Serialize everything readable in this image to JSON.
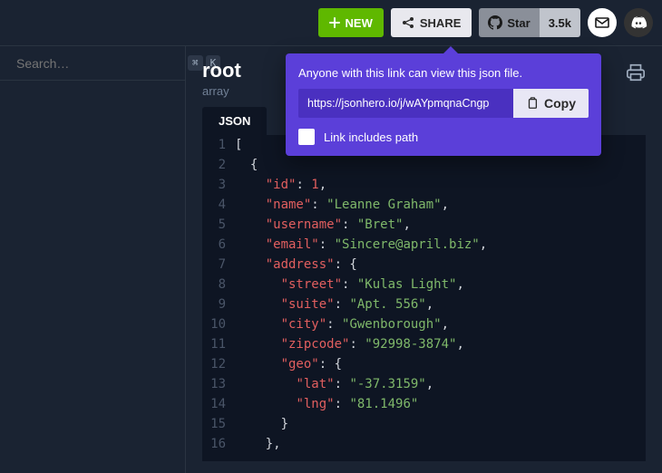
{
  "topbar": {
    "new_label": "NEW",
    "share_label": "SHARE",
    "github_star_label": "Star",
    "github_count": "3.5k"
  },
  "search": {
    "placeholder": "Search…",
    "kbd1": "⌘",
    "kbd2": "K"
  },
  "header": {
    "title": "root",
    "subtitle": "array"
  },
  "tabs": {
    "json_label": "JSON"
  },
  "share": {
    "desc": "Anyone with this link can view this json file.",
    "url": "https://jsonhero.io/j/wAYpmqnaCngp",
    "copy_label": "Copy",
    "checkbox_label": "Link includes path"
  },
  "code": {
    "lines": [
      {
        "n": "1",
        "tokens": [
          {
            "t": "[",
            "c": "punc"
          }
        ]
      },
      {
        "n": "2",
        "tokens": [
          {
            "t": "  {",
            "c": "punc"
          }
        ]
      },
      {
        "n": "3",
        "tokens": [
          {
            "t": "    ",
            "c": "punc"
          },
          {
            "t": "\"id\"",
            "c": "key"
          },
          {
            "t": ": ",
            "c": "punc"
          },
          {
            "t": "1",
            "c": "num"
          },
          {
            "t": ",",
            "c": "punc"
          }
        ]
      },
      {
        "n": "4",
        "tokens": [
          {
            "t": "    ",
            "c": "punc"
          },
          {
            "t": "\"name\"",
            "c": "key"
          },
          {
            "t": ": ",
            "c": "punc"
          },
          {
            "t": "\"Leanne Graham\"",
            "c": "str"
          },
          {
            "t": ",",
            "c": "punc"
          }
        ]
      },
      {
        "n": "5",
        "tokens": [
          {
            "t": "    ",
            "c": "punc"
          },
          {
            "t": "\"username\"",
            "c": "key"
          },
          {
            "t": ": ",
            "c": "punc"
          },
          {
            "t": "\"Bret\"",
            "c": "str"
          },
          {
            "t": ",",
            "c": "punc"
          }
        ]
      },
      {
        "n": "6",
        "tokens": [
          {
            "t": "    ",
            "c": "punc"
          },
          {
            "t": "\"email\"",
            "c": "key"
          },
          {
            "t": ": ",
            "c": "punc"
          },
          {
            "t": "\"Sincere@april.biz\"",
            "c": "str"
          },
          {
            "t": ",",
            "c": "punc"
          }
        ]
      },
      {
        "n": "7",
        "tokens": [
          {
            "t": "    ",
            "c": "punc"
          },
          {
            "t": "\"address\"",
            "c": "key"
          },
          {
            "t": ": {",
            "c": "punc"
          }
        ]
      },
      {
        "n": "8",
        "tokens": [
          {
            "t": "      ",
            "c": "punc"
          },
          {
            "t": "\"street\"",
            "c": "key"
          },
          {
            "t": ": ",
            "c": "punc"
          },
          {
            "t": "\"Kulas Light\"",
            "c": "str"
          },
          {
            "t": ",",
            "c": "punc"
          }
        ]
      },
      {
        "n": "9",
        "tokens": [
          {
            "t": "      ",
            "c": "punc"
          },
          {
            "t": "\"suite\"",
            "c": "key"
          },
          {
            "t": ": ",
            "c": "punc"
          },
          {
            "t": "\"Apt. 556\"",
            "c": "str"
          },
          {
            "t": ",",
            "c": "punc"
          }
        ]
      },
      {
        "n": "10",
        "tokens": [
          {
            "t": "      ",
            "c": "punc"
          },
          {
            "t": "\"city\"",
            "c": "key"
          },
          {
            "t": ": ",
            "c": "punc"
          },
          {
            "t": "\"Gwenborough\"",
            "c": "str"
          },
          {
            "t": ",",
            "c": "punc"
          }
        ]
      },
      {
        "n": "11",
        "tokens": [
          {
            "t": "      ",
            "c": "punc"
          },
          {
            "t": "\"zipcode\"",
            "c": "key"
          },
          {
            "t": ": ",
            "c": "punc"
          },
          {
            "t": "\"92998-3874\"",
            "c": "str"
          },
          {
            "t": ",",
            "c": "punc"
          }
        ]
      },
      {
        "n": "12",
        "tokens": [
          {
            "t": "      ",
            "c": "punc"
          },
          {
            "t": "\"geo\"",
            "c": "key"
          },
          {
            "t": ": {",
            "c": "punc"
          }
        ]
      },
      {
        "n": "13",
        "tokens": [
          {
            "t": "        ",
            "c": "punc"
          },
          {
            "t": "\"lat\"",
            "c": "key"
          },
          {
            "t": ": ",
            "c": "punc"
          },
          {
            "t": "\"-37.3159\"",
            "c": "str"
          },
          {
            "t": ",",
            "c": "punc"
          }
        ]
      },
      {
        "n": "14",
        "tokens": [
          {
            "t": "        ",
            "c": "punc"
          },
          {
            "t": "\"lng\"",
            "c": "key"
          },
          {
            "t": ": ",
            "c": "punc"
          },
          {
            "t": "\"81.1496\"",
            "c": "str"
          }
        ]
      },
      {
        "n": "15",
        "tokens": [
          {
            "t": "      }",
            "c": "punc"
          }
        ]
      },
      {
        "n": "16",
        "tokens": [
          {
            "t": "    },",
            "c": "punc"
          }
        ]
      }
    ]
  }
}
